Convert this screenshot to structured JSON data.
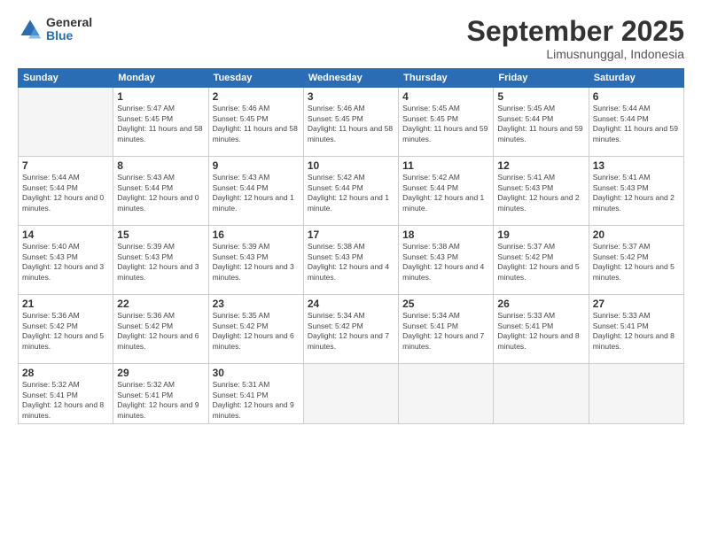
{
  "logo": {
    "general": "General",
    "blue": "Blue"
  },
  "header": {
    "month": "September 2025",
    "location": "Limusnunggal, Indonesia"
  },
  "weekdays": [
    "Sunday",
    "Monday",
    "Tuesday",
    "Wednesday",
    "Thursday",
    "Friday",
    "Saturday"
  ],
  "weeks": [
    [
      {
        "day": "",
        "empty": true
      },
      {
        "day": "1",
        "sunrise": "Sunrise: 5:47 AM",
        "sunset": "Sunset: 5:45 PM",
        "daylight": "Daylight: 11 hours and 58 minutes."
      },
      {
        "day": "2",
        "sunrise": "Sunrise: 5:46 AM",
        "sunset": "Sunset: 5:45 PM",
        "daylight": "Daylight: 11 hours and 58 minutes."
      },
      {
        "day": "3",
        "sunrise": "Sunrise: 5:46 AM",
        "sunset": "Sunset: 5:45 PM",
        "daylight": "Daylight: 11 hours and 58 minutes."
      },
      {
        "day": "4",
        "sunrise": "Sunrise: 5:45 AM",
        "sunset": "Sunset: 5:45 PM",
        "daylight": "Daylight: 11 hours and 59 minutes."
      },
      {
        "day": "5",
        "sunrise": "Sunrise: 5:45 AM",
        "sunset": "Sunset: 5:44 PM",
        "daylight": "Daylight: 11 hours and 59 minutes."
      },
      {
        "day": "6",
        "sunrise": "Sunrise: 5:44 AM",
        "sunset": "Sunset: 5:44 PM",
        "daylight": "Daylight: 11 hours and 59 minutes."
      }
    ],
    [
      {
        "day": "7",
        "sunrise": "Sunrise: 5:44 AM",
        "sunset": "Sunset: 5:44 PM",
        "daylight": "Daylight: 12 hours and 0 minutes."
      },
      {
        "day": "8",
        "sunrise": "Sunrise: 5:43 AM",
        "sunset": "Sunset: 5:44 PM",
        "daylight": "Daylight: 12 hours and 0 minutes."
      },
      {
        "day": "9",
        "sunrise": "Sunrise: 5:43 AM",
        "sunset": "Sunset: 5:44 PM",
        "daylight": "Daylight: 12 hours and 1 minute."
      },
      {
        "day": "10",
        "sunrise": "Sunrise: 5:42 AM",
        "sunset": "Sunset: 5:44 PM",
        "daylight": "Daylight: 12 hours and 1 minute."
      },
      {
        "day": "11",
        "sunrise": "Sunrise: 5:42 AM",
        "sunset": "Sunset: 5:44 PM",
        "daylight": "Daylight: 12 hours and 1 minute."
      },
      {
        "day": "12",
        "sunrise": "Sunrise: 5:41 AM",
        "sunset": "Sunset: 5:43 PM",
        "daylight": "Daylight: 12 hours and 2 minutes."
      },
      {
        "day": "13",
        "sunrise": "Sunrise: 5:41 AM",
        "sunset": "Sunset: 5:43 PM",
        "daylight": "Daylight: 12 hours and 2 minutes."
      }
    ],
    [
      {
        "day": "14",
        "sunrise": "Sunrise: 5:40 AM",
        "sunset": "Sunset: 5:43 PM",
        "daylight": "Daylight: 12 hours and 3 minutes."
      },
      {
        "day": "15",
        "sunrise": "Sunrise: 5:39 AM",
        "sunset": "Sunset: 5:43 PM",
        "daylight": "Daylight: 12 hours and 3 minutes."
      },
      {
        "day": "16",
        "sunrise": "Sunrise: 5:39 AM",
        "sunset": "Sunset: 5:43 PM",
        "daylight": "Daylight: 12 hours and 3 minutes."
      },
      {
        "day": "17",
        "sunrise": "Sunrise: 5:38 AM",
        "sunset": "Sunset: 5:43 PM",
        "daylight": "Daylight: 12 hours and 4 minutes."
      },
      {
        "day": "18",
        "sunrise": "Sunrise: 5:38 AM",
        "sunset": "Sunset: 5:43 PM",
        "daylight": "Daylight: 12 hours and 4 minutes."
      },
      {
        "day": "19",
        "sunrise": "Sunrise: 5:37 AM",
        "sunset": "Sunset: 5:42 PM",
        "daylight": "Daylight: 12 hours and 5 minutes."
      },
      {
        "day": "20",
        "sunrise": "Sunrise: 5:37 AM",
        "sunset": "Sunset: 5:42 PM",
        "daylight": "Daylight: 12 hours and 5 minutes."
      }
    ],
    [
      {
        "day": "21",
        "sunrise": "Sunrise: 5:36 AM",
        "sunset": "Sunset: 5:42 PM",
        "daylight": "Daylight: 12 hours and 5 minutes."
      },
      {
        "day": "22",
        "sunrise": "Sunrise: 5:36 AM",
        "sunset": "Sunset: 5:42 PM",
        "daylight": "Daylight: 12 hours and 6 minutes."
      },
      {
        "day": "23",
        "sunrise": "Sunrise: 5:35 AM",
        "sunset": "Sunset: 5:42 PM",
        "daylight": "Daylight: 12 hours and 6 minutes."
      },
      {
        "day": "24",
        "sunrise": "Sunrise: 5:34 AM",
        "sunset": "Sunset: 5:42 PM",
        "daylight": "Daylight: 12 hours and 7 minutes."
      },
      {
        "day": "25",
        "sunrise": "Sunrise: 5:34 AM",
        "sunset": "Sunset: 5:41 PM",
        "daylight": "Daylight: 12 hours and 7 minutes."
      },
      {
        "day": "26",
        "sunrise": "Sunrise: 5:33 AM",
        "sunset": "Sunset: 5:41 PM",
        "daylight": "Daylight: 12 hours and 8 minutes."
      },
      {
        "day": "27",
        "sunrise": "Sunrise: 5:33 AM",
        "sunset": "Sunset: 5:41 PM",
        "daylight": "Daylight: 12 hours and 8 minutes."
      }
    ],
    [
      {
        "day": "28",
        "sunrise": "Sunrise: 5:32 AM",
        "sunset": "Sunset: 5:41 PM",
        "daylight": "Daylight: 12 hours and 8 minutes."
      },
      {
        "day": "29",
        "sunrise": "Sunrise: 5:32 AM",
        "sunset": "Sunset: 5:41 PM",
        "daylight": "Daylight: 12 hours and 9 minutes."
      },
      {
        "day": "30",
        "sunrise": "Sunrise: 5:31 AM",
        "sunset": "Sunset: 5:41 PM",
        "daylight": "Daylight: 12 hours and 9 minutes."
      },
      {
        "day": "",
        "empty": true
      },
      {
        "day": "",
        "empty": true
      },
      {
        "day": "",
        "empty": true
      },
      {
        "day": "",
        "empty": true
      }
    ]
  ]
}
